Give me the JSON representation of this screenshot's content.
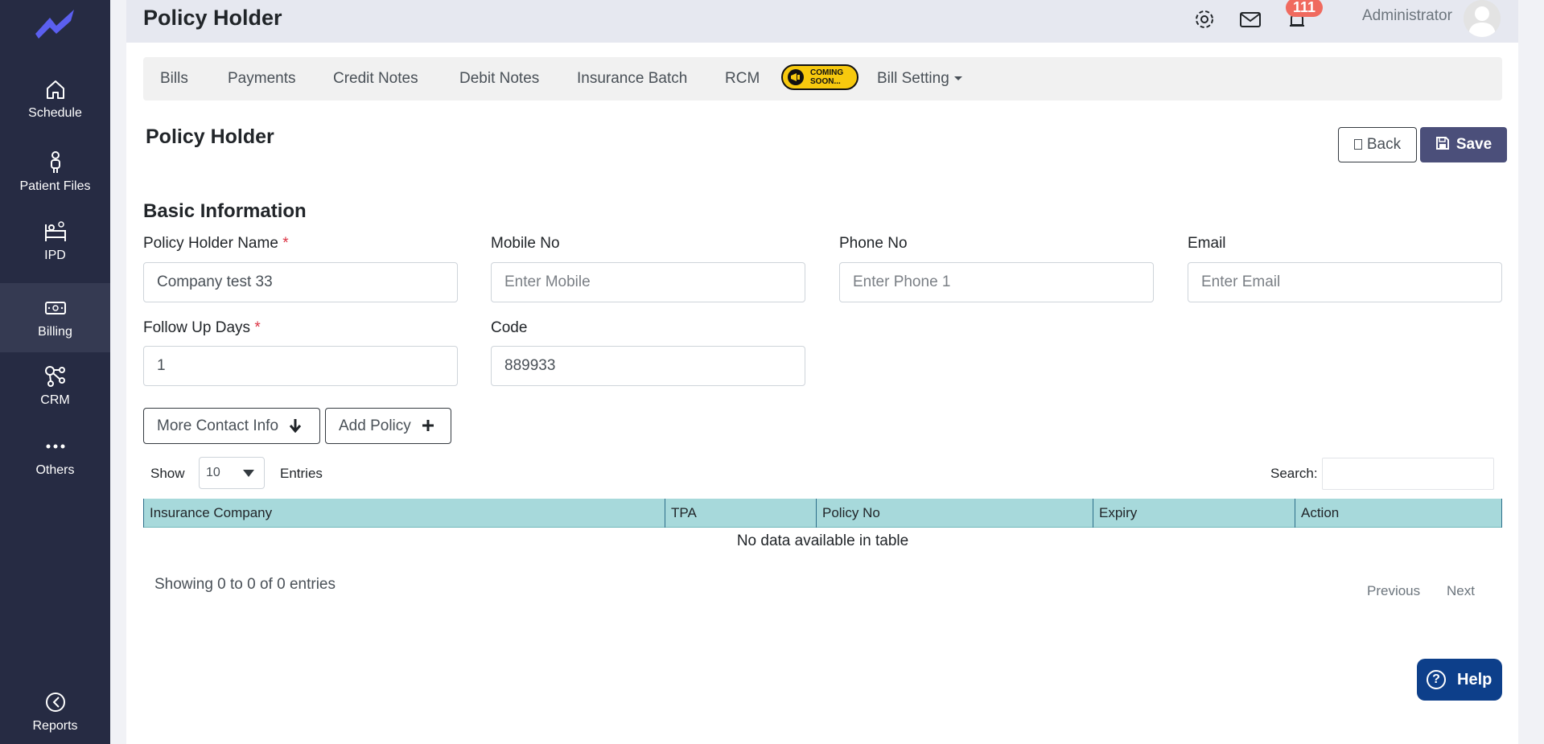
{
  "sidebar": {
    "items": [
      {
        "label": "Schedule",
        "icon": "home-icon"
      },
      {
        "label": "Patient Files",
        "icon": "person-icon"
      },
      {
        "label": "IPD",
        "icon": "bed-icon"
      },
      {
        "label": "Billing",
        "icon": "money-icon",
        "active": true
      },
      {
        "label": "CRM",
        "icon": "network-icon"
      },
      {
        "label": "Others",
        "icon": "more-dots-icon"
      },
      {
        "label": "Reports",
        "icon": "pie-chart-icon"
      }
    ]
  },
  "header": {
    "title": "Policy Holder",
    "notification_count": "111",
    "user_name": "Administrator"
  },
  "subnav": {
    "tabs": [
      "Bills",
      "Payments",
      "Credit Notes",
      "Debit Notes",
      "Insurance Batch",
      "RCM",
      "Bill Setting"
    ],
    "coming_soon_line1": "COMING",
    "coming_soon_line2": "SOON..."
  },
  "page": {
    "title": "Policy Holder",
    "back_label": "Back",
    "save_label": "Save",
    "section_title": "Basic Information"
  },
  "form": {
    "policy_holder_name": {
      "label": "Policy Holder Name",
      "required": "*",
      "value": "Company test 33"
    },
    "mobile_no": {
      "label": "Mobile No",
      "placeholder": "Enter Mobile"
    },
    "phone_no": {
      "label": "Phone No",
      "placeholder": "Enter Phone 1"
    },
    "email": {
      "label": "Email",
      "placeholder": "Enter Email"
    },
    "follow_up_days": {
      "label": "Follow Up Days",
      "required": "*",
      "value": "1"
    },
    "code": {
      "label": "Code",
      "value": "889933"
    }
  },
  "actions": {
    "more_contact_label": "More Contact Info",
    "add_policy_label": "Add Policy"
  },
  "table": {
    "show_label": "Show",
    "page_size": "10",
    "entries_label": "Entries",
    "search_label": "Search:",
    "columns": [
      "Insurance Company",
      "TPA",
      "Policy No",
      "Expiry",
      "Action"
    ],
    "empty_message": "No data available in table",
    "info": "Showing 0 to 0 of 0 entries",
    "previous_label": "Previous",
    "next_label": "Next"
  },
  "help": {
    "label": "Help"
  },
  "colors": {
    "sidebar_bg": "#262b43",
    "accent_save": "#4b4f7a",
    "table_header": "#a7d9db",
    "badge": "#f06a5f",
    "help_bg": "#0d3f8a"
  }
}
